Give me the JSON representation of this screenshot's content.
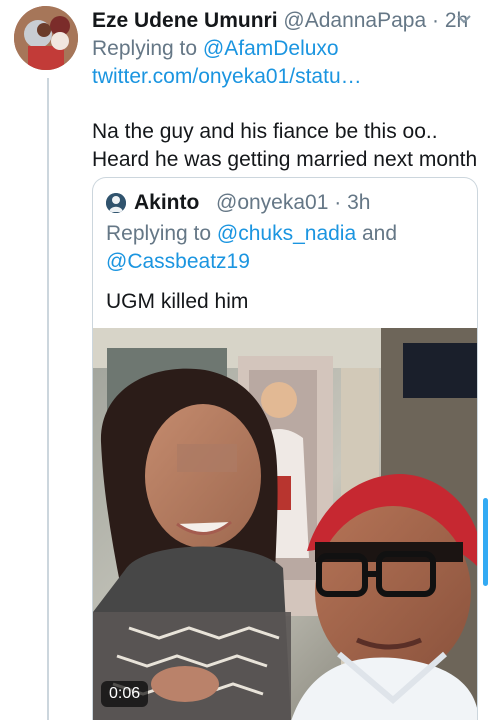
{
  "tweet": {
    "author_name": "Eze Udene Umunri",
    "author_handle": "@AdannaPapa",
    "separator": "·",
    "time": "2h",
    "replying_prefix": "Replying to",
    "replying_mention": "@AfamDeluxo",
    "link": "twitter.com/onyeka01/statu…",
    "text_lines": [
      "Na the guy and his fiance be this oo..",
      "Heard he was getting married next month"
    ]
  },
  "quoted_tweet": {
    "author_name": "Akinto",
    "author_handle": "@onyeka01",
    "separator": "·",
    "time": "3h",
    "replying_prefix": "Replying to",
    "replying_mention_1": "@chuks_nadia",
    "replying_and": "and",
    "replying_mention_2": "@Cassbeatz19",
    "text": "UGM killed him",
    "video_duration": "0:06"
  },
  "icons": {
    "caret": "chevron-down-icon",
    "avatar": "avatar",
    "quoted_avatar": "avatar"
  },
  "colors": {
    "link": "#1b95e0",
    "secondary_text": "#657786",
    "border": "#ccd6dd",
    "scrollbar": "#1da1f2"
  }
}
